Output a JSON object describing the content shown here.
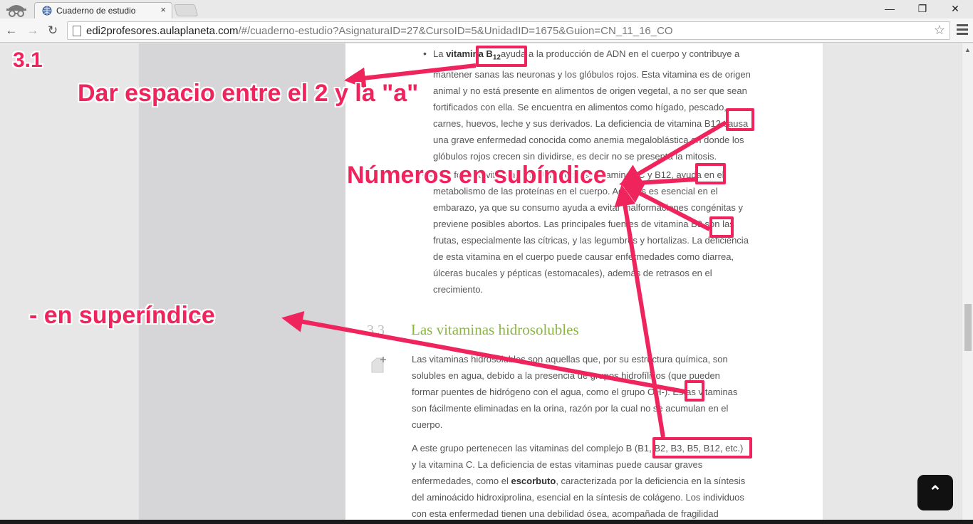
{
  "browser": {
    "tab_title": "Cuaderno de estudio",
    "tab_close": "×",
    "url_host": "edi2profesores.aulaplaneta.com",
    "url_path": "/#/cuaderno-estudio?AsignaturaID=27&CursoID=5&UnidadID=1675&Guion=CN_11_16_CO",
    "minimize": "—",
    "maximize": "❐",
    "close": "✕",
    "back": "←",
    "forward": "→",
    "reload": "↻",
    "star": "☆"
  },
  "icons": [
    "incognito-icon",
    "globe-favicon-icon",
    "page-icon",
    "star-icon",
    "menu-icon",
    "add-note-icon",
    "arrow-up-icon"
  ],
  "content": {
    "p1_bullet": "•",
    "p1_lines": [
      [
        "La ",
        "vitamina B",
        "12",
        "ayuda a la producción de ADN en el cuerpo y contribuye a"
      ],
      "mantener sanas las neuronas y los glóbulos rojos. Esta vitamina es de origen",
      "animal y no está presente en alimentos de origen vegetal, a no ser que sean",
      "fortificados con ella. Se encuentra en alimentos como hígado, pescado,",
      "carnes, huevos, leche y sus derivados. La deficiencia de vitamina B12 causa",
      "una grave enfermedad conocida como anemia megaloblástica en donde los",
      "glóbulos rojos crecen sin dividirse, es decir no se presenta la mitosis."
    ],
    "p2_lines": [
      "• Ácido fólico o vitamina B9. Junto con las vitaminas C y B12, ayuda en el",
      "metabolismo de las proteínas en el cuerpo. Además es esencial en el",
      "embarazo, ya que su consumo ayuda a evitar malformaciones congénitas y",
      "previene posibles abortos. Las principales fuentes de vitamina B9 son las",
      "frutas, especialmente las cítricas, y las legumbres y hortalizas. La deficiencia",
      "de esta vitamina en el cuerpo puede causar enfermedades como diarrea,",
      "úlceras bucales y pépticas (estomacales), además de retrasos en el",
      "crecimiento."
    ],
    "section_number": "3.3",
    "section_title": "Las vitaminas hidrosolubles",
    "p3_lines": [
      "Las vitaminas hidrosolubles son aquellas que, por su estructura química, son",
      "solubles en agua, debido a la presencia de grupos hidrofílicos (que pueden",
      "formar puentes de hidrógeno con el agua, como el grupo OH-). Estas vitaminas",
      "son fácilmente eliminadas en la orina, razón por la cual no se acumulan en el",
      "cuerpo."
    ],
    "p4_lines": [
      "A este grupo pertenecen las vitaminas del complejo B (B1, B2, B3, B5, B12, etc.)",
      "y la vitamina C. La deficiencia de estas vitaminas puede causar graves",
      [
        "enfermedades, como el ",
        "escorbuto",
        ", caracterizada por la deficiencia en la síntesis"
      ],
      "del aminoácido hidroxiprolina, esencial en la síntesis de colágeno. Los individuos",
      "con esta enfermedad tienen una debilidad ósea, acompañada de fragilidad"
    ],
    "back_to_top": "⌃"
  },
  "annotations": {
    "label_section": "3.1",
    "label_space": "Dar espacio entre el 2 y la \"a\"",
    "label_subindex": "Números en subíndice",
    "label_superindex": "- en superíndice",
    "color": "#f0245c"
  }
}
